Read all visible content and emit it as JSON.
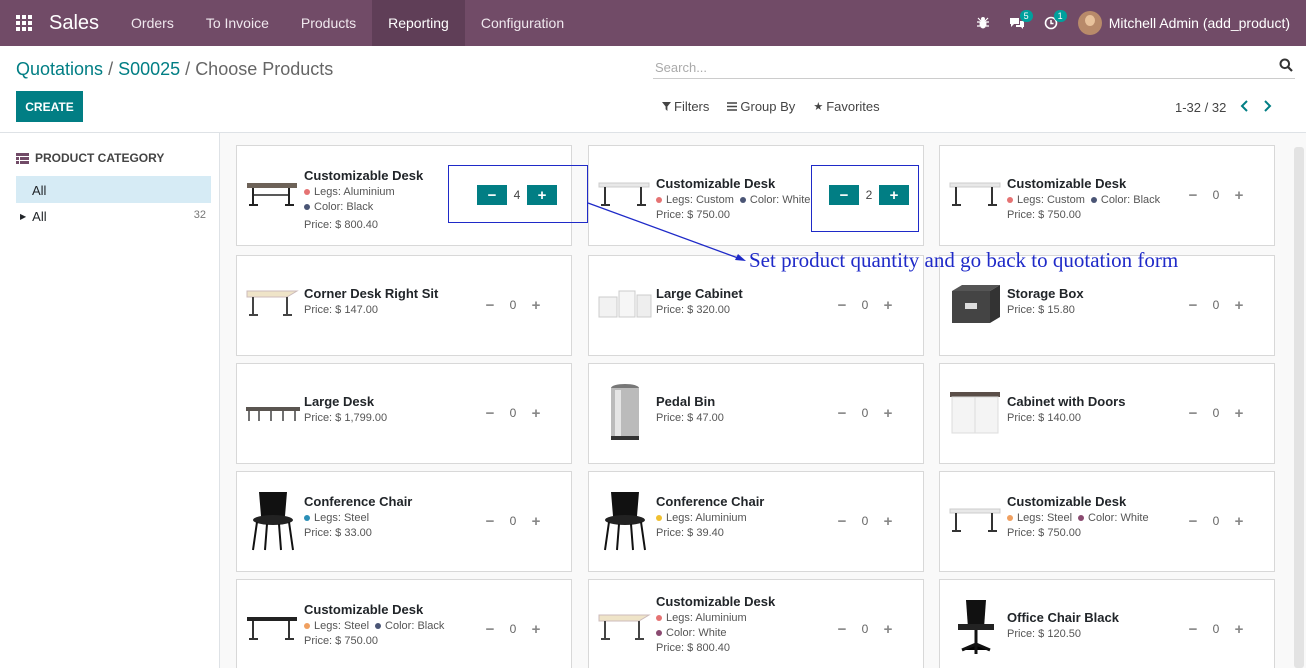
{
  "topbar": {
    "app": "Sales",
    "menu": [
      "Orders",
      "To Invoice",
      "Products",
      "Reporting",
      "Configuration"
    ],
    "active_menu": "Reporting",
    "messages_badge": "5",
    "activities_badge": "1",
    "user": "Mitchell Admin (add_product)"
  },
  "control": {
    "breadcrumb": {
      "part1": "Quotations",
      "part2": "S00025",
      "current": "Choose Products"
    },
    "create_label": "CREATE",
    "search_placeholder": "Search...",
    "filters": "Filters",
    "group_by": "Group By",
    "favorites": "Favorites",
    "pager": "1-32 / 32"
  },
  "sidebar": {
    "title": "PRODUCT CATEGORY",
    "selected": "All",
    "tree_item": "All",
    "tree_count": "32"
  },
  "annotation": "Set product quantity and go back to quotation form",
  "products": [
    {
      "name": "Customizable Desk",
      "attrs": [
        {
          "text": "Legs: Aluminium",
          "color": "#e57373"
        },
        {
          "text": "Color: Black",
          "color": "#4a5575"
        }
      ],
      "price": "Price: $ 800.40",
      "qty": "4",
      "active": true,
      "img": "desk-dark"
    },
    {
      "name": "Customizable Desk",
      "attrs": [
        {
          "text": "Legs: Custom",
          "color": "#e57373"
        },
        {
          "text": "Color: White",
          "color": "#4a5575"
        }
      ],
      "price": "Price: $ 750.00",
      "qty": "2",
      "active": true,
      "img": "desk-white"
    },
    {
      "name": "Customizable Desk",
      "attrs": [
        {
          "text": "Legs: Custom",
          "color": "#e57373"
        },
        {
          "text": "Color: Black",
          "color": "#4a5575"
        }
      ],
      "price": "Price: $ 750.00",
      "qty": "0",
      "active": false,
      "img": "desk-white"
    },
    {
      "name": "Corner Desk Right Sit",
      "attrs": [],
      "price": "Price: $ 147.00",
      "qty": "0",
      "active": false,
      "img": "desk-light"
    },
    {
      "name": "Large Cabinet",
      "attrs": [],
      "price": "Price: $ 320.00",
      "qty": "0",
      "active": false,
      "img": "cabinet"
    },
    {
      "name": "Storage Box",
      "attrs": [],
      "price": "Price: $ 15.80",
      "qty": "0",
      "active": false,
      "img": "box"
    },
    {
      "name": "Large Desk",
      "attrs": [],
      "price": "Price: $ 1,799.00",
      "qty": "0",
      "active": false,
      "img": "desk-large"
    },
    {
      "name": "Pedal Bin",
      "attrs": [],
      "price": "Price: $ 47.00",
      "qty": "0",
      "active": false,
      "img": "bin"
    },
    {
      "name": "Cabinet with Doors",
      "attrs": [],
      "price": "Price: $ 140.00",
      "qty": "0",
      "active": false,
      "img": "cabinet-doors"
    },
    {
      "name": "Conference Chair",
      "attrs": [
        {
          "text": "Legs: Steel",
          "color": "#2b8fb7"
        }
      ],
      "price": "Price: $ 33.00",
      "qty": "0",
      "active": false,
      "img": "chair"
    },
    {
      "name": "Conference Chair",
      "attrs": [
        {
          "text": "Legs: Aluminium",
          "color": "#f0c030"
        }
      ],
      "price": "Price: $ 39.40",
      "qty": "0",
      "active": false,
      "img": "chair"
    },
    {
      "name": "Customizable Desk",
      "attrs": [
        {
          "text": "Legs: Steel",
          "color": "#f0a060"
        },
        {
          "text": "Color: White",
          "color": "#8a4a70"
        }
      ],
      "price": "Price: $ 750.00",
      "qty": "0",
      "active": false,
      "img": "desk-white"
    },
    {
      "name": "Customizable Desk",
      "attrs": [
        {
          "text": "Legs: Steel",
          "color": "#f0a060"
        },
        {
          "text": "Color: Black",
          "color": "#4a5575"
        }
      ],
      "price": "Price: $ 750.00",
      "qty": "0",
      "active": false,
      "img": "desk-black"
    },
    {
      "name": "Customizable Desk",
      "attrs": [
        {
          "text": "Legs: Aluminium",
          "color": "#e57373"
        },
        {
          "text": "Color: White",
          "color": "#8a4a70"
        }
      ],
      "price": "Price: $ 800.40",
      "qty": "0",
      "active": false,
      "img": "desk-light"
    },
    {
      "name": "Office Chair Black",
      "attrs": [],
      "price": "Price: $ 120.50",
      "qty": "0",
      "active": false,
      "img": "office-chair"
    }
  ]
}
